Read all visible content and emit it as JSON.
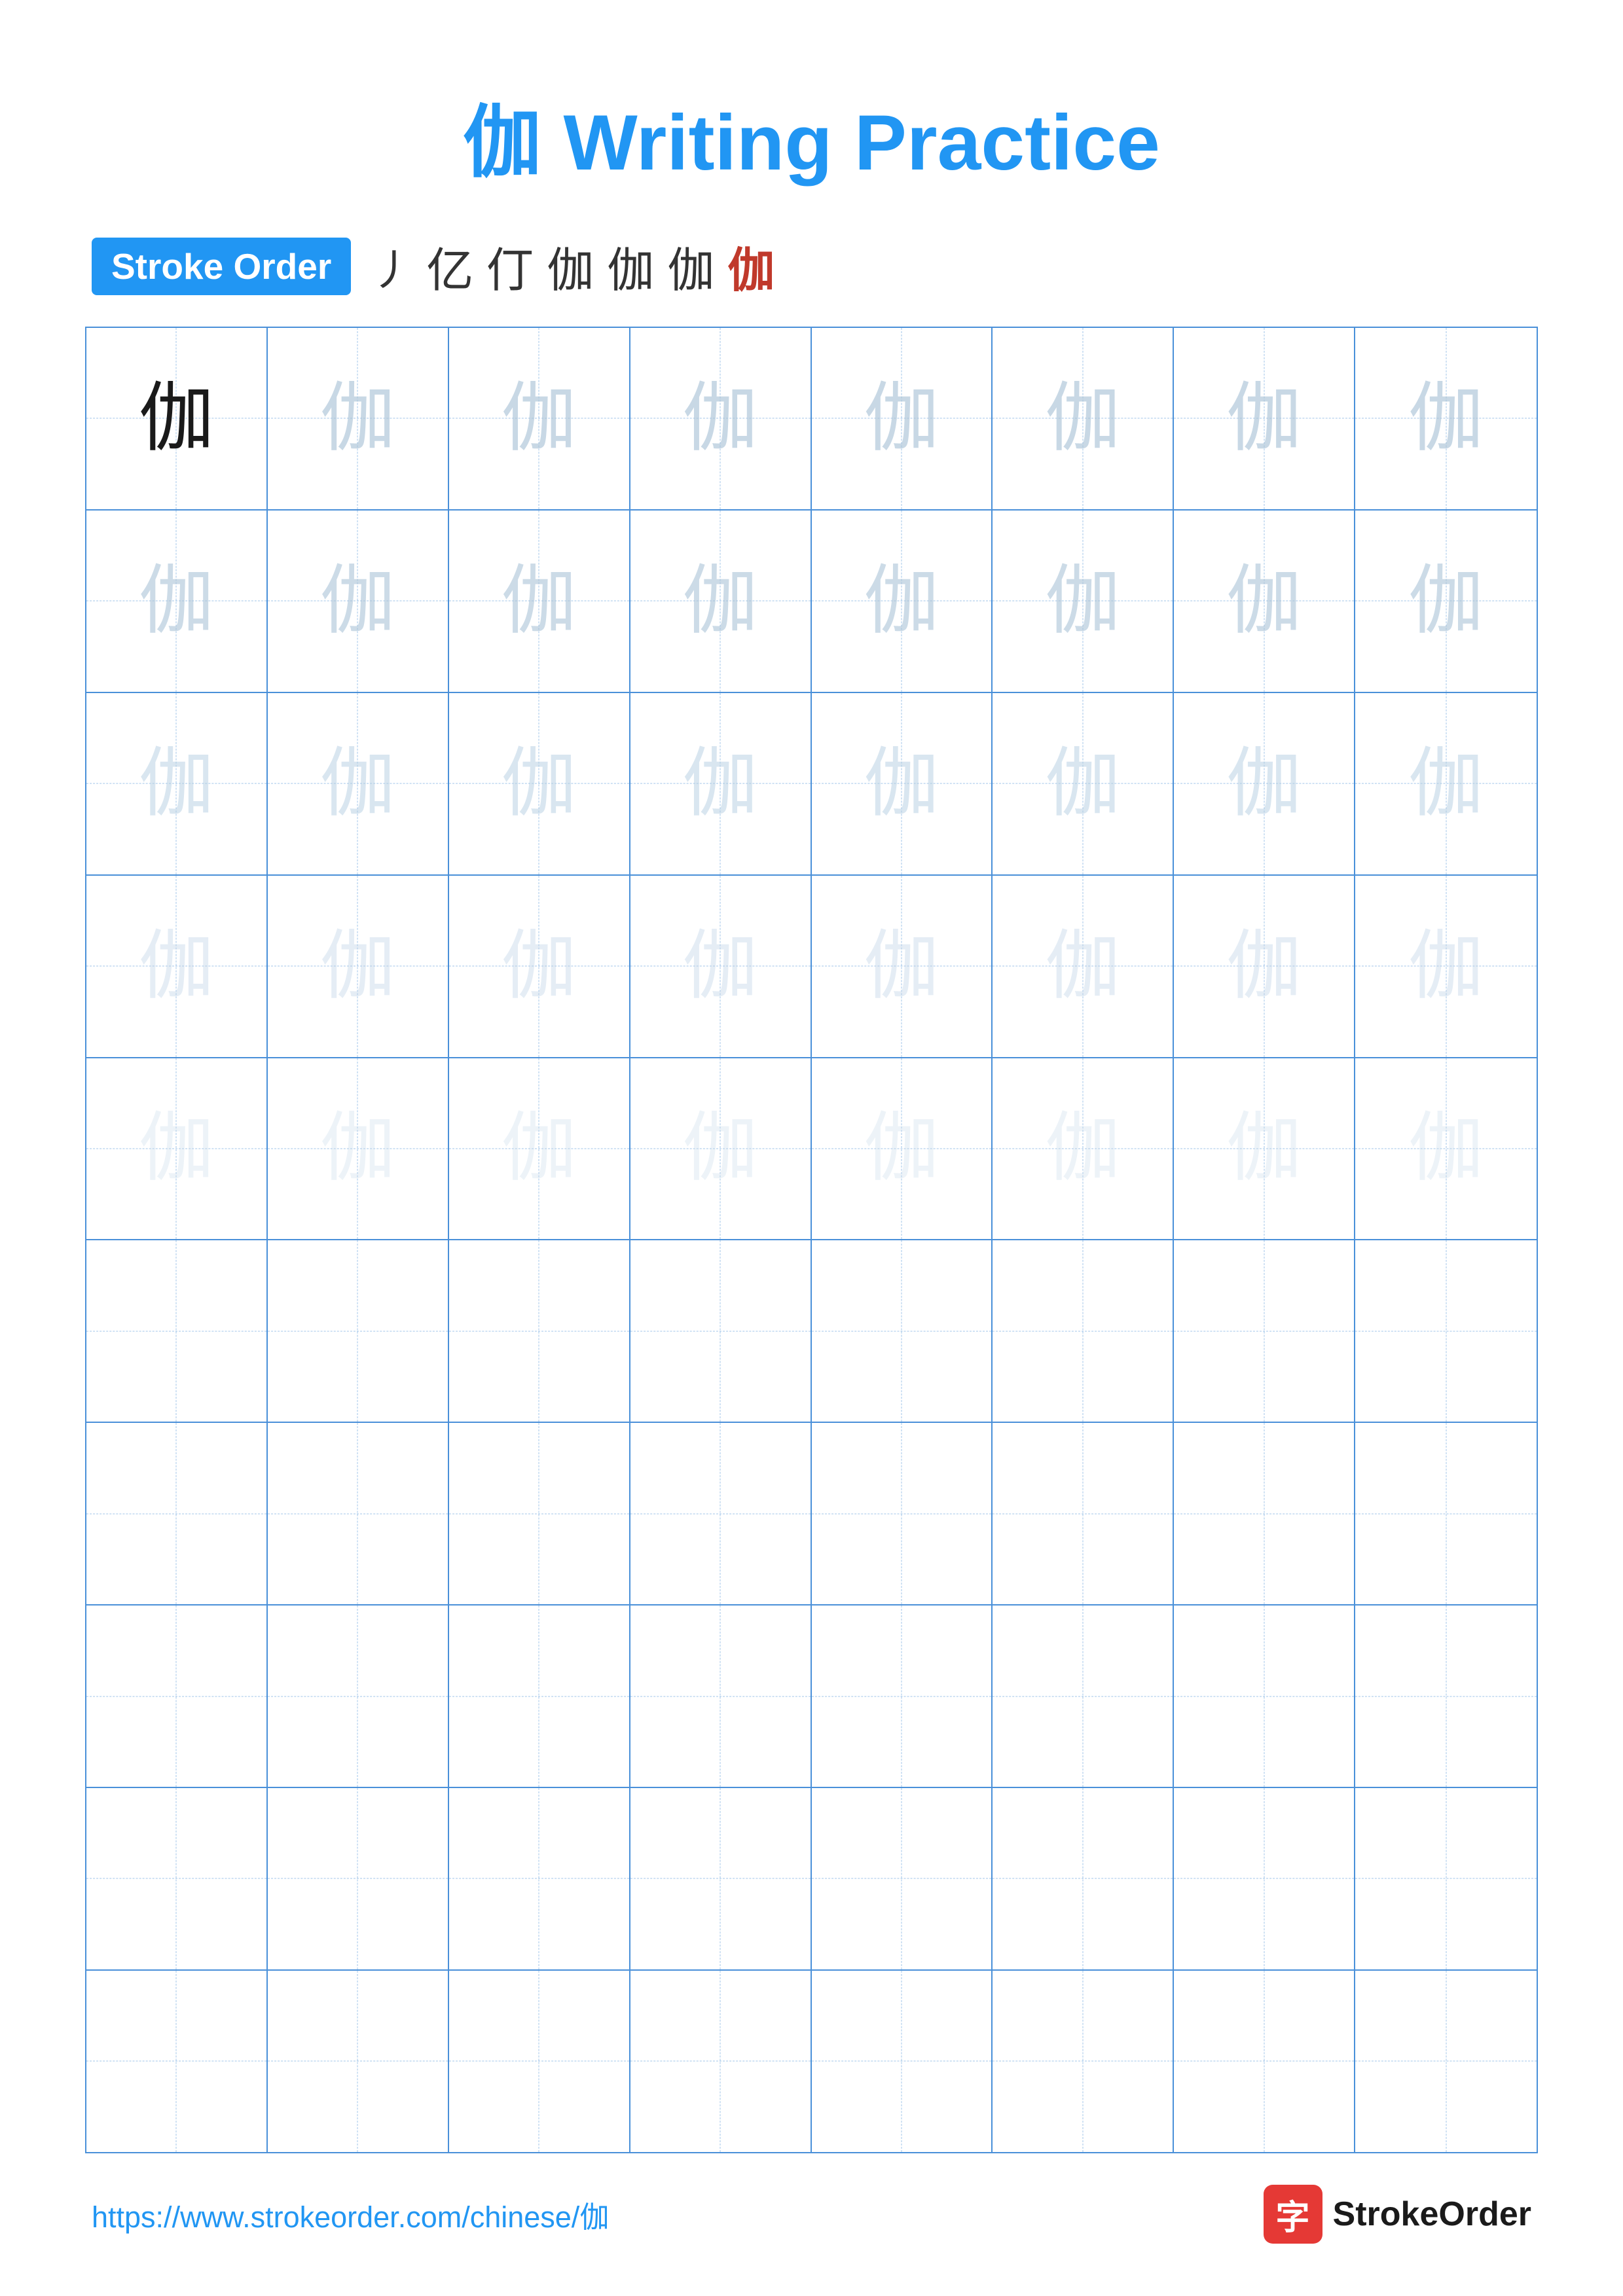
{
  "page": {
    "title": "伽 Writing Practice",
    "title_char": "伽",
    "title_suffix": " Writing Practice"
  },
  "stroke_order": {
    "badge_label": "Stroke Order",
    "sequence": [
      "丨",
      "亿",
      "仃",
      "伽",
      "伽",
      "伽",
      "伽"
    ]
  },
  "grid": {
    "rows": 10,
    "cols": 8,
    "character": "伽",
    "filled_rows": 5
  },
  "footer": {
    "url": "https://www.strokeorder.com/chinese/伽",
    "logo_char": "字",
    "logo_text": "StrokeOrder"
  }
}
